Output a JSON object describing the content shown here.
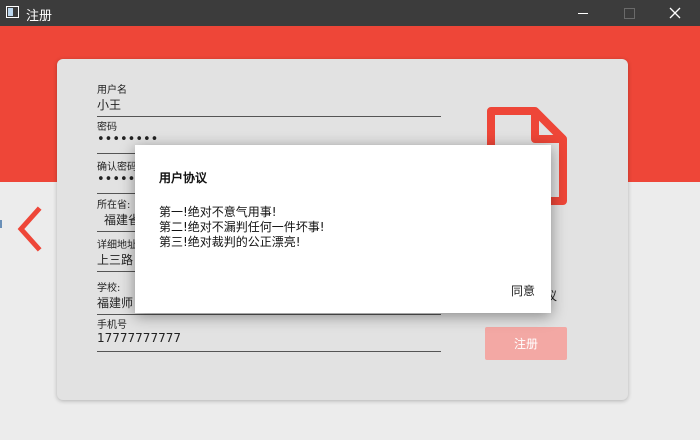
{
  "window": {
    "title": "注册"
  },
  "form": {
    "username": {
      "label": "用户名",
      "value": "小王"
    },
    "password": {
      "label": "密码",
      "value": "••••••••"
    },
    "confirm_password": {
      "label": "确认密码",
      "value": "••••••"
    },
    "province": {
      "label": "所在省:",
      "value": "福建省"
    },
    "address": {
      "label": "详细地址",
      "value": "上三路"
    },
    "school": {
      "label": "学校:",
      "value": "福建师"
    },
    "phone": {
      "label": "手机号",
      "value": "17777777777"
    }
  },
  "side": {
    "agree_fragment": "议",
    "register_label": "注册"
  },
  "dialog": {
    "title": "用户协议",
    "lines": [
      "第一!绝对不意气用事!",
      "第二!绝对不漏判任何一件坏事!",
      "第三!绝对裁判的公正漂亮!"
    ],
    "ok_label": "同意"
  },
  "colors": {
    "accent": "#ee4638",
    "titlebar": "#3c3c3c",
    "register_disabled": "#f3a8a4"
  }
}
